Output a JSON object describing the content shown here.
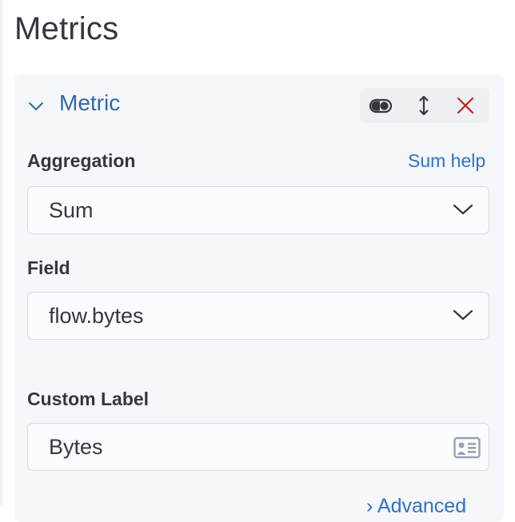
{
  "page": {
    "title": "Metrics"
  },
  "metric": {
    "title": "Metric",
    "actions": {
      "toggle_icon": "toggle-icon",
      "drag_icon": "drag-vertical-icon",
      "remove_icon": "close-icon"
    },
    "aggregation": {
      "label": "Aggregation",
      "help_link": "Sum help",
      "value": "Sum"
    },
    "field": {
      "label": "Field",
      "value": "flow.bytes"
    },
    "custom_label": {
      "label": "Custom Label",
      "value": "Bytes"
    },
    "advanced_link": "Advanced"
  },
  "colors": {
    "accent": "#3169a8",
    "link": "#2f73c4",
    "danger": "#bd271e",
    "text": "#343741",
    "panel_bg": "#f5f7fa"
  }
}
